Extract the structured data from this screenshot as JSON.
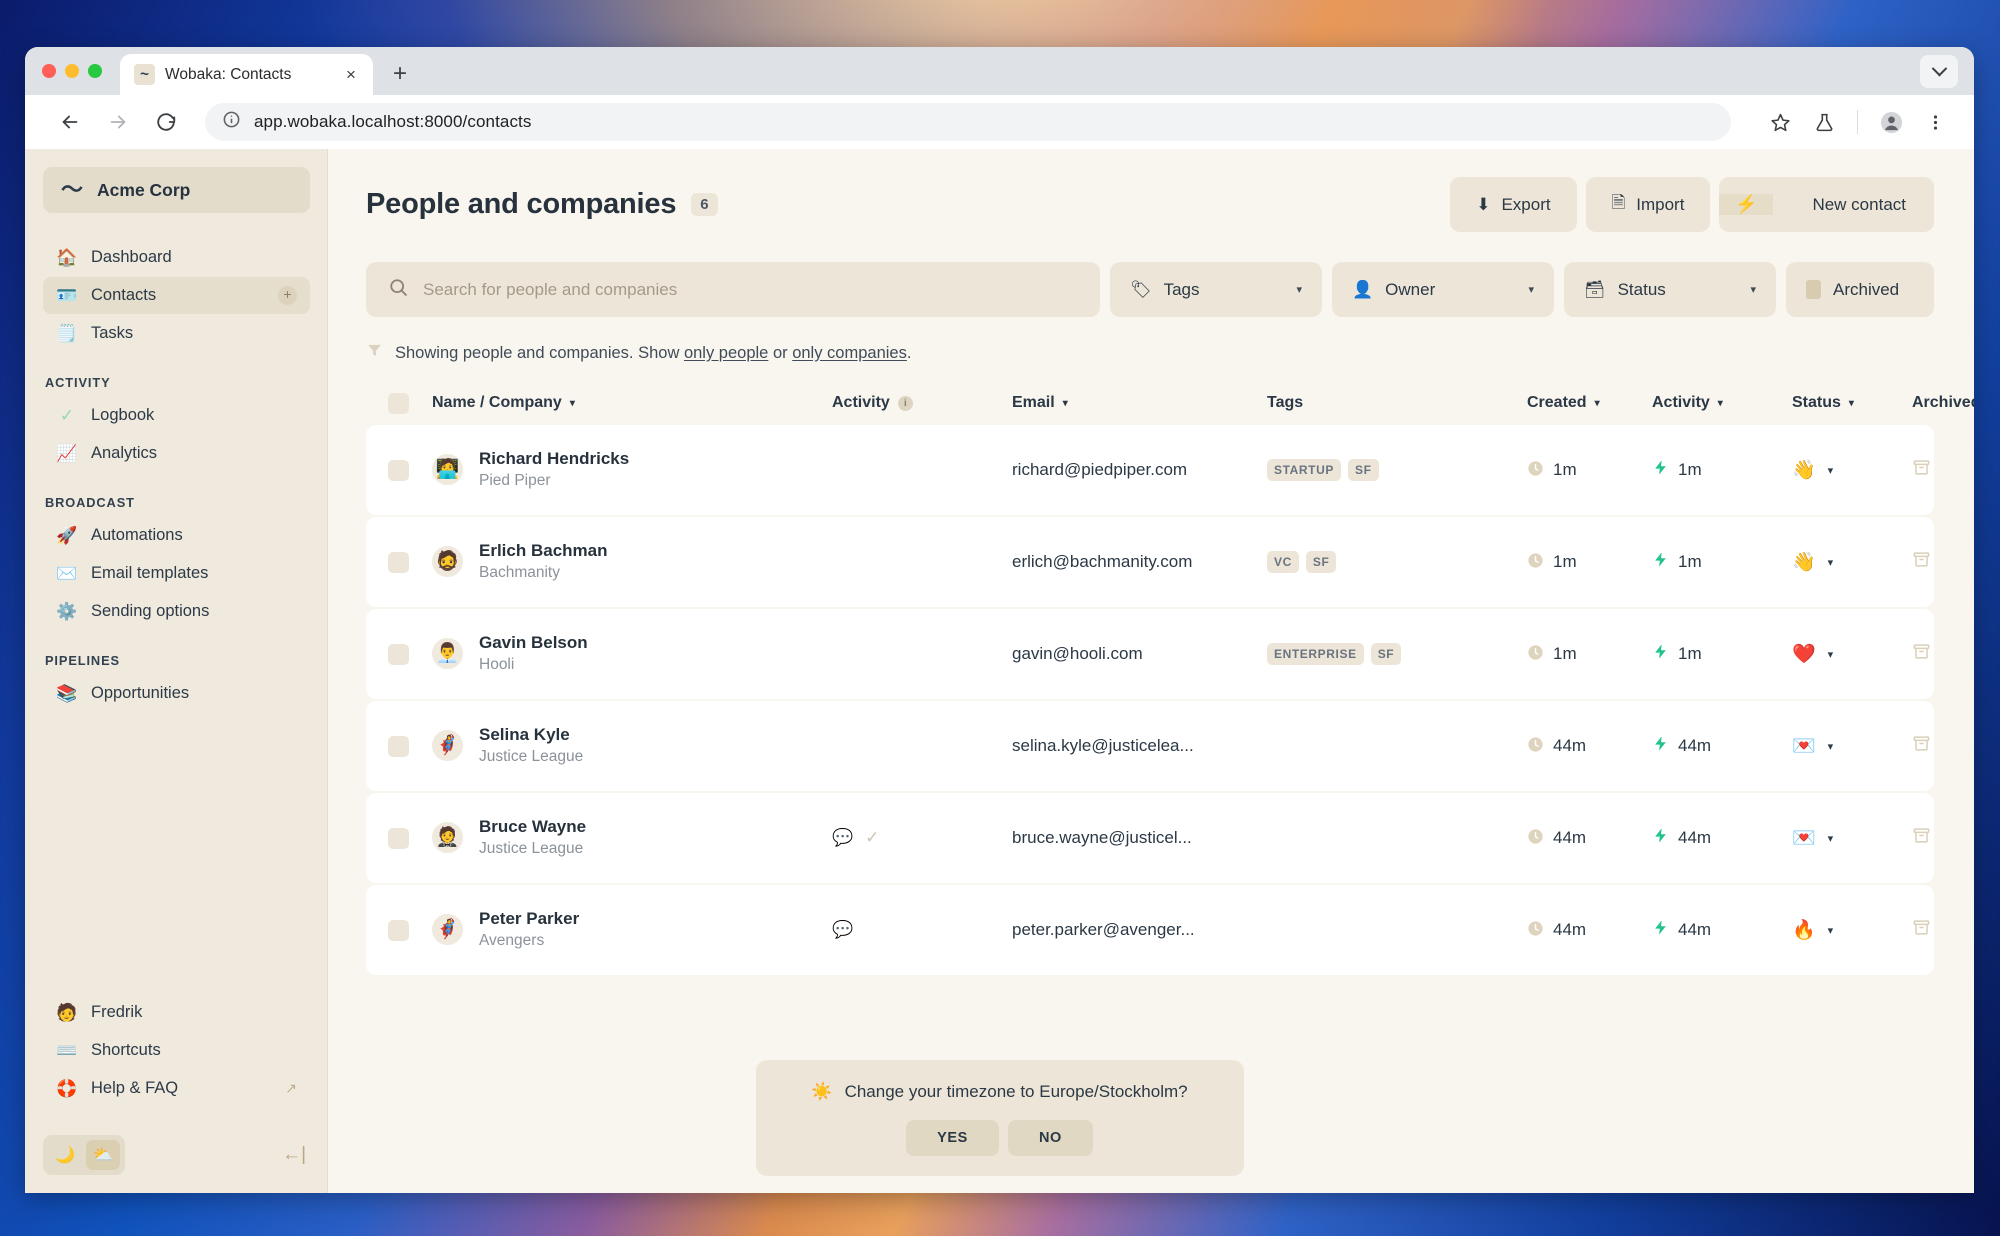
{
  "browser": {
    "tab_title": "Wobaka: Contacts",
    "tab_favicon": "~",
    "close_label": "×",
    "newtab_label": "+",
    "url": "app.wobaka.localhost:8000/contacts"
  },
  "sidebar": {
    "org": {
      "logo": "〜",
      "name": "Acme Corp"
    },
    "primary": [
      {
        "label": "Dashboard",
        "icon": "🏠",
        "name": "dashboard",
        "active": false
      },
      {
        "label": "Contacts",
        "icon": "🪪",
        "name": "contacts",
        "active": true,
        "plus": "+"
      },
      {
        "label": "Tasks",
        "icon": "🗒️",
        "name": "tasks",
        "active": false
      }
    ],
    "groups": [
      {
        "label": "ACTIVITY",
        "items": [
          {
            "label": "Logbook",
            "icon": "✓",
            "name": "logbook"
          },
          {
            "label": "Analytics",
            "icon": "📈",
            "name": "analytics"
          }
        ]
      },
      {
        "label": "BROADCAST",
        "items": [
          {
            "label": "Automations",
            "icon": "🚀",
            "name": "automations"
          },
          {
            "label": "Email templates",
            "icon": "✉️",
            "name": "email-templates"
          },
          {
            "label": "Sending options",
            "icon": "⚙️",
            "name": "sending-options"
          }
        ]
      },
      {
        "label": "PIPELINES",
        "items": [
          {
            "label": "Opportunities",
            "icon": "📚",
            "name": "opportunities"
          }
        ]
      }
    ],
    "bottom": [
      {
        "label": "Fredrik",
        "icon": "🧑",
        "name": "user-fredrik"
      },
      {
        "label": "Shortcuts",
        "icon": "⌨️",
        "name": "shortcuts"
      },
      {
        "label": "Help & FAQ",
        "icon": "🛟",
        "name": "help-faq",
        "external": "↗"
      }
    ],
    "theme": {
      "dark_icon": "🌙",
      "auto_icon": "⛅",
      "collapse_icon": "←|"
    }
  },
  "header": {
    "title": "People and companies",
    "count": "6",
    "export_label": "Export",
    "export_icon": "⬇",
    "import_label": "Import",
    "import_icon": "🗎",
    "new_contact_label": "New contact",
    "new_contact_icon": "⚡"
  },
  "search": {
    "placeholder": "Search for people and companies",
    "value": "",
    "icon": "🔍"
  },
  "filters": [
    {
      "label": "Tags",
      "icon": "🏷",
      "name": "tags",
      "caret": "▾"
    },
    {
      "label": "Owner",
      "icon": "👤",
      "name": "owner",
      "caret": "▾"
    },
    {
      "label": "Status",
      "icon": "🗃",
      "name": "status",
      "caret": "▾"
    },
    {
      "label": "Archived",
      "icon": "",
      "name": "archived",
      "caret": ""
    }
  ],
  "showing": {
    "prefix": "Showing people and companies. Show ",
    "link_people": "only people",
    "middle": " or ",
    "link_companies": "only companies",
    "suffix": "."
  },
  "table": {
    "columns": [
      {
        "label": "Name / Company",
        "name": "name-company",
        "caret": "▾"
      },
      {
        "label": "Activity",
        "name": "activity-left",
        "info": "i"
      },
      {
        "label": "Email",
        "name": "email",
        "caret": "▾"
      },
      {
        "label": "Tags",
        "name": "tags"
      },
      {
        "label": "Created",
        "name": "created",
        "caret": "▾"
      },
      {
        "label": "Activity",
        "name": "activity",
        "caret": "▾"
      },
      {
        "label": "Status",
        "name": "status",
        "caret": "▾"
      },
      {
        "label": "Archived",
        "name": "archived",
        "caret": "▾"
      }
    ],
    "rows": [
      {
        "name": "Richard Hendricks",
        "company": "Pied Piper",
        "avatar": "🧑‍💻",
        "activity_icons": [],
        "email": "richard@piedpiper.com",
        "tags": [
          "STARTUP",
          "SF"
        ],
        "created": "1m",
        "activity": "1m",
        "status_emoji": "👋",
        "archived_icon": "🗃"
      },
      {
        "name": "Erlich Bachman",
        "company": "Bachmanity",
        "avatar": "🧔",
        "activity_icons": [],
        "email": "erlich@bachmanity.com",
        "tags": [
          "VC",
          "SF"
        ],
        "created": "1m",
        "activity": "1m",
        "status_emoji": "👋",
        "archived_icon": "🗃"
      },
      {
        "name": "Gavin Belson",
        "company": "Hooli",
        "avatar": "👨‍💼",
        "activity_icons": [],
        "email": "gavin@hooli.com",
        "tags": [
          "ENTERPRISE",
          "SF"
        ],
        "created": "1m",
        "activity": "1m",
        "status_emoji": "❤️",
        "archived_icon": "🗃"
      },
      {
        "name": "Selina Kyle",
        "company": "Justice League",
        "avatar": "🦸‍♀️",
        "activity_icons": [],
        "email": "selina.kyle@justicelea...",
        "tags": [],
        "created": "44m",
        "activity": "44m",
        "status_emoji": "💌",
        "archived_icon": "🗃"
      },
      {
        "name": "Bruce Wayne",
        "company": "Justice League",
        "avatar": "🤵",
        "activity_icons": [
          "💬",
          "✓"
        ],
        "email": "bruce.wayne@justicel...",
        "tags": [],
        "created": "44m",
        "activity": "44m",
        "status_emoji": "💌",
        "archived_icon": "🗃"
      },
      {
        "name": "Peter Parker",
        "company": "Avengers",
        "avatar": "🦸",
        "activity_icons": [
          "💬"
        ],
        "email": "peter.parker@avenger...",
        "tags": [],
        "created": "44m",
        "activity": "44m",
        "status_emoji": "🔥",
        "archived_icon": "🗃"
      }
    ]
  },
  "toast": {
    "icon": "☀️",
    "message": "Change your timezone to Europe/Stockholm?",
    "yes_label": "YES",
    "no_label": "NO"
  },
  "colors": {
    "app_bg": "#F9F6F0",
    "sidebar_bg": "#EFE9DE",
    "surface": "#EDE6D8",
    "row_bg": "#FFFFFF",
    "text": "#2B3845",
    "muted": "#8B929A",
    "accent_green": "#22C48A"
  }
}
